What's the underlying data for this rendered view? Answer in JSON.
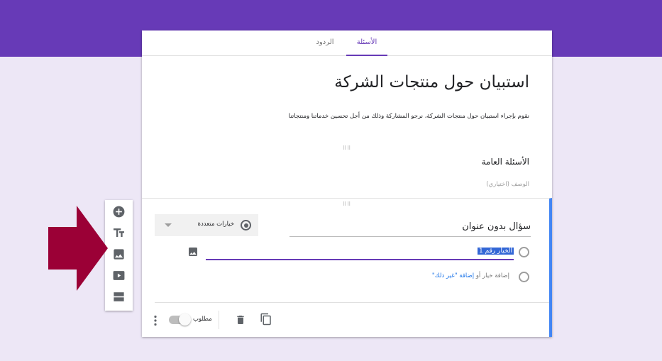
{
  "header": {
    "color": "#673ab7"
  },
  "tabs": [
    {
      "label": "الأسئلة",
      "active": true
    },
    {
      "label": "الردود",
      "active": false
    }
  ],
  "form": {
    "title": "استبيان حول منتجات الشركة",
    "description": "نقوم بإجراء استبيان حول منتجات الشركة، نرجو المشاركة وذلك من أجل تحسين خدماتنا ومنتجاتنا"
  },
  "section": {
    "title": "الأسئلة العامة",
    "description_placeholder": "الوصف (اختياري)"
  },
  "question": {
    "title": "سؤال بدون عنوان",
    "type_label": "خيارات متعددة",
    "option_1": "الخيار رقم 1",
    "add_option": "إضافة خيار أو",
    "add_other": "إضافة \"غير ذلك\"",
    "required_label": "مطلوب",
    "required": false
  },
  "toolbar_icons": [
    "add-question-icon",
    "add-title-icon",
    "add-image-icon",
    "add-video-icon",
    "add-section-icon"
  ],
  "colors": {
    "accent": "#673ab7",
    "focus_border": "#4285f4",
    "annotation_arrow": "#9b0036",
    "link": "#1a73e8"
  }
}
